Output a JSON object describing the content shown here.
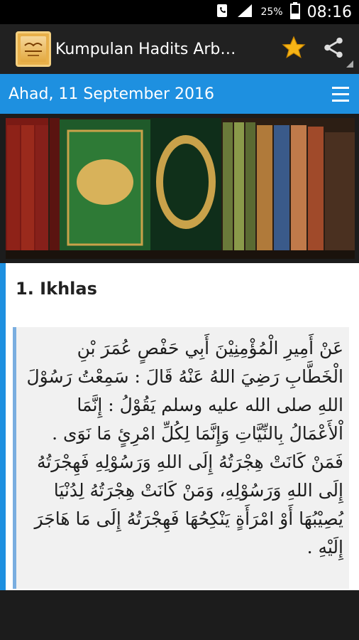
{
  "status_bar": {
    "battery_percent": "25%",
    "time": "08:16",
    "icons": [
      "phone-vibrate-icon",
      "signal-icon",
      "battery-icon"
    ]
  },
  "action_bar": {
    "title": "Kumpulan Hadits Arb…",
    "logo_text": "الأربعين النووية",
    "icons": [
      "star-icon",
      "share-icon"
    ]
  },
  "date_bar": {
    "date": "Ahad, 11 September 2016",
    "icon": "menu-icon"
  },
  "hadith": {
    "title": "1. Ikhlas",
    "text": "عَنْ أَمِيرِ الْمُؤْمِنِيْنَ أَبِي حَفْصٍ عُمَرَ بْنِ الْخَطَّابِ رَضِيَ اللهُ عَنْهُ قَالَ : سَمِعْتُ رَسُوْلَ اللهِ صلى الله عليه وسلم يَقُوْلُ : إِنَّمَا اْلأَعْمَالُ بِالنِّيَّاتِ وَإِنَّمَا لِكُلِّ امْرِئٍ مَا نَوَى . فَمَنْ كَانَتْ هِجْرَتُهُ إِلَى اللهِ وَرَسُوْلِهِ فَهِجْرَتُهُ إِلَى اللهِ وَرَسُوْلِهِ، وَمَنْ كَانَتْ هِجْرَتُهُ لِدُنْيَا يُصِيْبُهَا أَوْ امْرَأَةٍ يَنْكِحُهَا فَهِجْرَتُهُ إِلَى مَا هَاجَرَ إِلَيْهِ ."
  },
  "colors": {
    "accent": "#1e90e0",
    "action_bar": "#212121",
    "star": "#f6b416"
  }
}
